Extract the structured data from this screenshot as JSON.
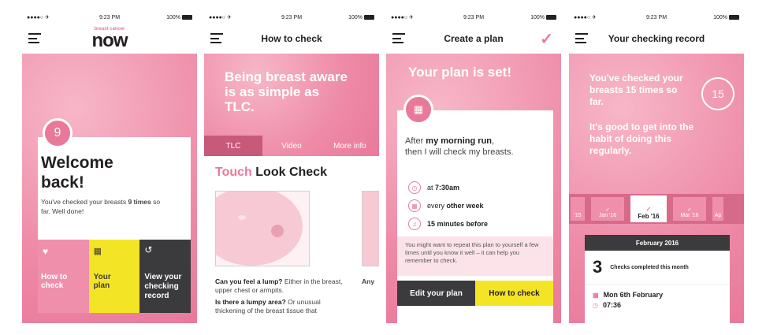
{
  "status": {
    "carrier": "●●●●○ ✈",
    "time": "9:23 PM",
    "battery": "100%"
  },
  "colors": {
    "pink": "#e9799a",
    "dark": "#3b3a3c",
    "yellow": "#f4e426",
    "light_pink": "#f6c9d5"
  },
  "screen1": {
    "logo_small": "breast cancer",
    "logo_big": "now",
    "badge": "9",
    "welcome": "Welcome back!",
    "msg_pre": "You've checked your breasts ",
    "msg_bold": "9 times",
    "msg_post": " so far. Well done!",
    "tiles": [
      {
        "icon": "heart-icon",
        "label": "How to check"
      },
      {
        "icon": "calendar-icon",
        "label": "Your plan"
      },
      {
        "icon": "history-icon",
        "label": "View your checking record"
      }
    ]
  },
  "screen2": {
    "title": "How to check",
    "hero": "Being breast aware is as simple as TLC.",
    "tabs": [
      "TLC",
      "Video",
      "More info"
    ],
    "tlc": {
      "touch": "Touch",
      "look": "Look",
      "check": "Check"
    },
    "q1_bold": "Can you feel a lump?",
    "q1_text": " Either in the breast, upper chest or armpits.",
    "q2_bold": "Is there a lumpy area?",
    "q2_text": " Or unusual thickening of the breast tissue that",
    "side_text": "Any... lar...",
    "side_bold": "Any"
  },
  "screen3": {
    "title": "Create a plan",
    "check": "✓",
    "hero": "Your plan is set!",
    "after_pre": "After ",
    "after_bold": "my morning run",
    "after_post": ",",
    "then": "then I will check my breasts.",
    "details": [
      {
        "icon": "clock-icon",
        "pre": "at ",
        "bold": "7:30am"
      },
      {
        "icon": "calendar-icon",
        "pre": "every ",
        "bold": "other week"
      },
      {
        "icon": "bell-icon",
        "pre": "",
        "bold": "15 minutes before"
      }
    ],
    "note": "You might want to repeat this plan to yourself a few times until you know it well – it can help you remember to check.",
    "edit": "Edit your plan",
    "howto": "How to check"
  },
  "screen4": {
    "title": "Your checking record",
    "hero1": "You've checked your breasts 15 times so far.",
    "hero2": "It's good to get into the habit of doing this regularly.",
    "count": "15",
    "months": [
      "'15",
      "Jan '16",
      "Feb '16",
      "Mar '16",
      "Ap"
    ],
    "card_head": "February 2016",
    "card_num": "3",
    "card_label": "Checks completed this month",
    "entry_date": "Mon 6th February",
    "entry_time": "07:36"
  }
}
